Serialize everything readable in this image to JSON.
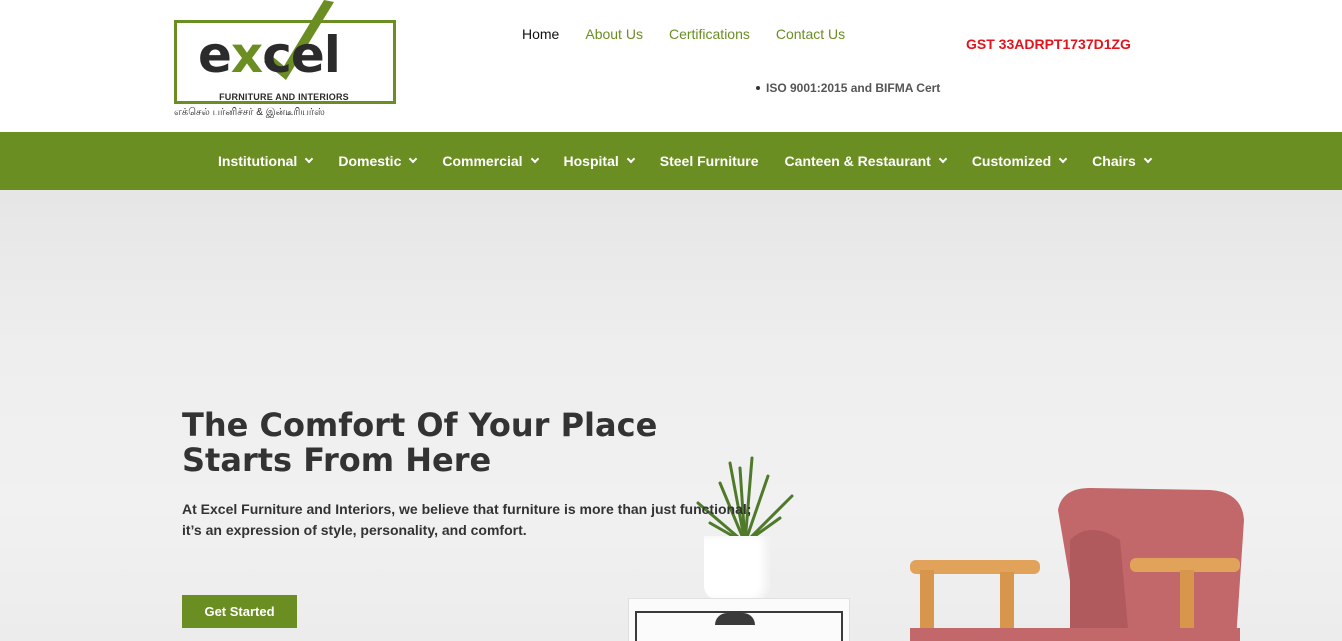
{
  "brand": {
    "word_prefix": "e",
    "word_x": "x",
    "word_suffix": "cel",
    "tagline": "FURNITURE AND INTERIORS",
    "tamil": "எக்செல் பர்னிச்சர் & இன்டீரியர்ஸ்"
  },
  "topnav": [
    {
      "label": "Home",
      "active": true
    },
    {
      "label": "About Us",
      "active": false
    },
    {
      "label": "Certifications",
      "active": false
    },
    {
      "label": "Contact Us",
      "active": false
    }
  ],
  "gst": "GST 33ADRPT1737D1ZG",
  "iso": "ISO 9001:2015 and BIFMA Cert",
  "mainnav": [
    {
      "label": "Institutional",
      "dropdown": true
    },
    {
      "label": "Domestic",
      "dropdown": true
    },
    {
      "label": "Commercial",
      "dropdown": true
    },
    {
      "label": "Hospital",
      "dropdown": true
    },
    {
      "label": "Steel Furniture",
      "dropdown": false
    },
    {
      "label": "Canteen & Restaurant",
      "dropdown": true
    },
    {
      "label": "Customized",
      "dropdown": true
    },
    {
      "label": "Chairs",
      "dropdown": true
    }
  ],
  "hero": {
    "title_line1": "The Comfort Of Your Place",
    "title_line2": "Starts From Here",
    "text_line1": "At Excel Furniture and Interiors, we believe that furniture is more than just functional;",
    "text_line2": "it’s an expression of style, personality, and comfort.",
    "cta": "Get Started"
  },
  "colors": {
    "brand_green": "#6b8e23",
    "gst_red": "#e3141b",
    "text_dark": "#333333"
  }
}
